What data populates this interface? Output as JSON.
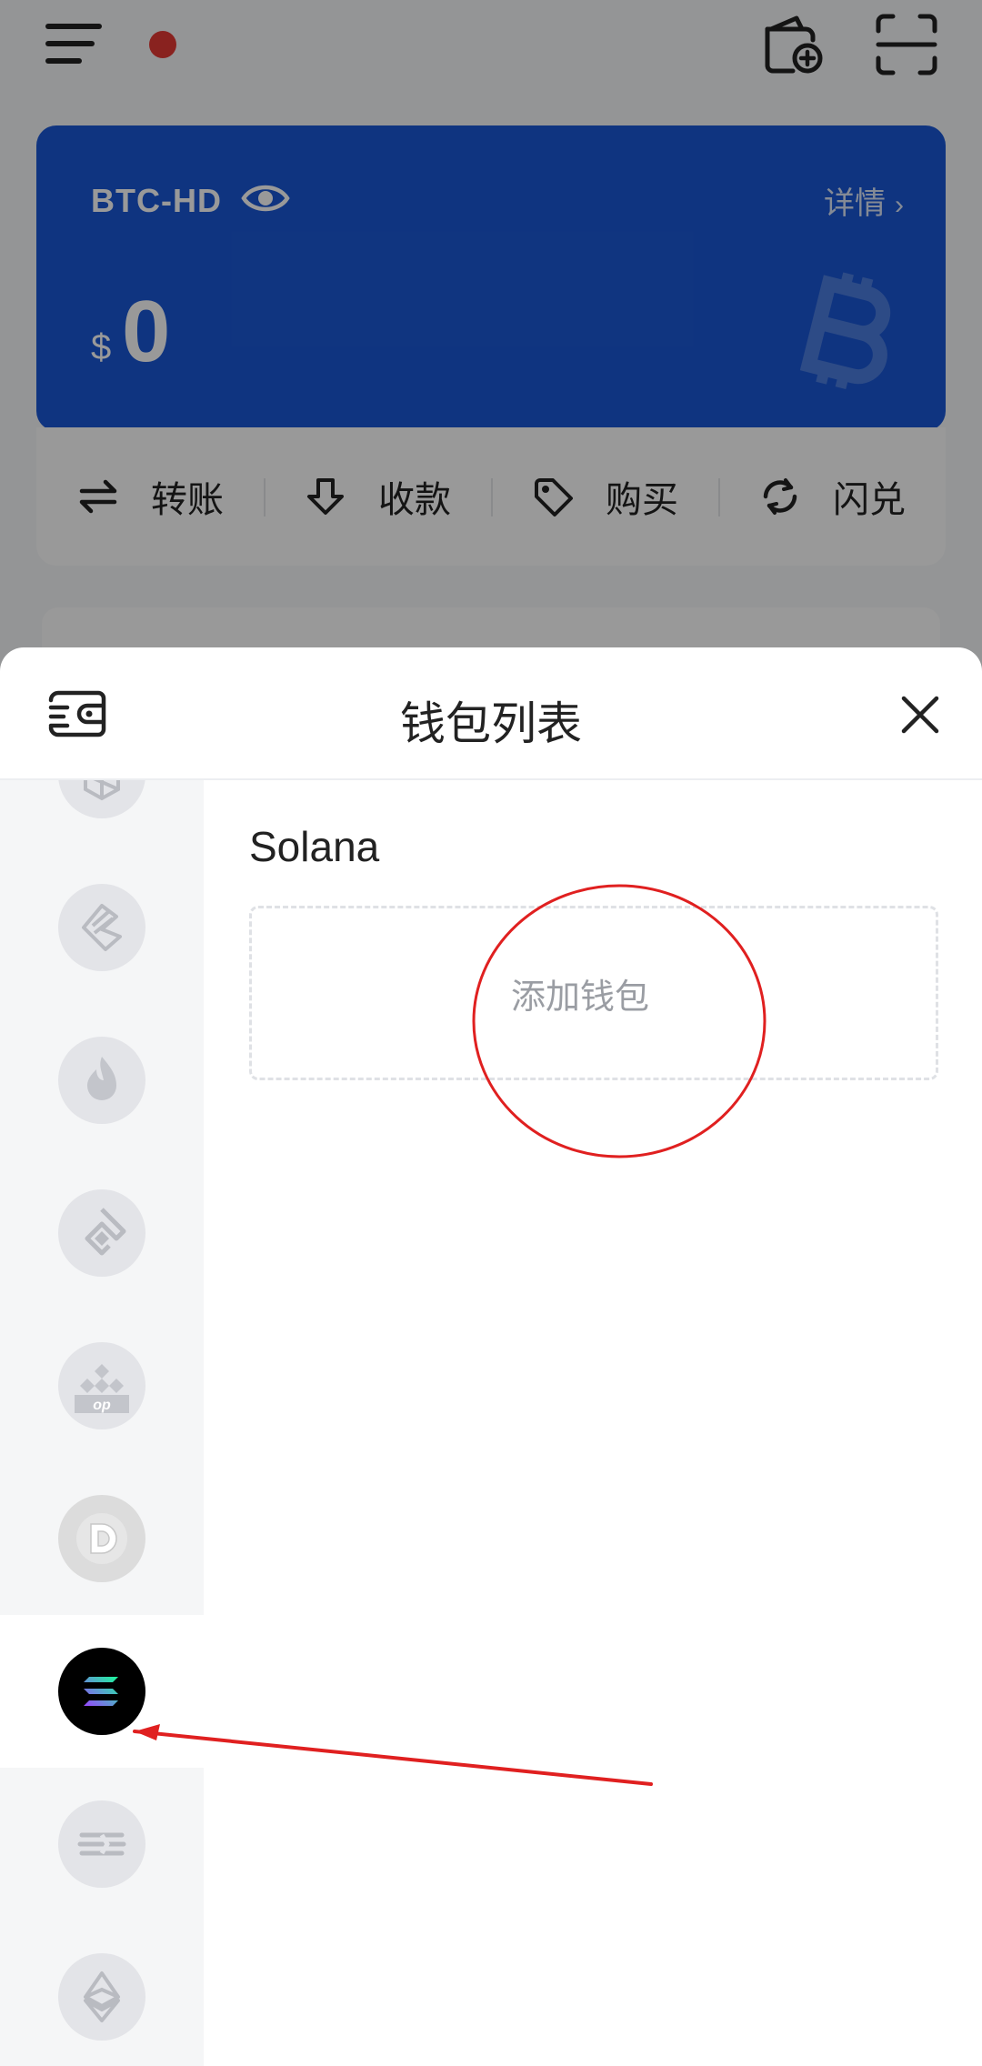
{
  "app": {
    "wallet_card": {
      "name": "BTC-HD",
      "details_label": "详情",
      "currency_symbol": "$",
      "balance": "0"
    },
    "actions": [
      {
        "label": "转账",
        "icon": "transfer-icon"
      },
      {
        "label": "收款",
        "icon": "receive-icon"
      },
      {
        "label": "购买",
        "icon": "buy-tag-icon"
      },
      {
        "label": "闪兑",
        "icon": "swap-icon"
      }
    ],
    "colors": {
      "card_blue": "#1a58d6",
      "status_dot": "#e53935",
      "annotation_red": "#e02020"
    }
  },
  "sheet": {
    "title": "钱包列表",
    "selected_chain": "Solana",
    "add_wallet_label": "添加钱包",
    "chains": [
      {
        "icon": "fantom-icon",
        "active": false
      },
      {
        "icon": "lrc-icon",
        "active": false
      },
      {
        "icon": "heco-flame-icon",
        "active": false
      },
      {
        "icon": "conflux-icon",
        "active": false
      },
      {
        "icon": "opbnb-icon",
        "active": false
      },
      {
        "icon": "dogecoin-icon",
        "active": false
      },
      {
        "icon": "solana-icon",
        "active": true
      },
      {
        "icon": "aptos-like-icon",
        "active": false
      },
      {
        "icon": "ethereum-classic-icon",
        "active": false
      }
    ]
  }
}
